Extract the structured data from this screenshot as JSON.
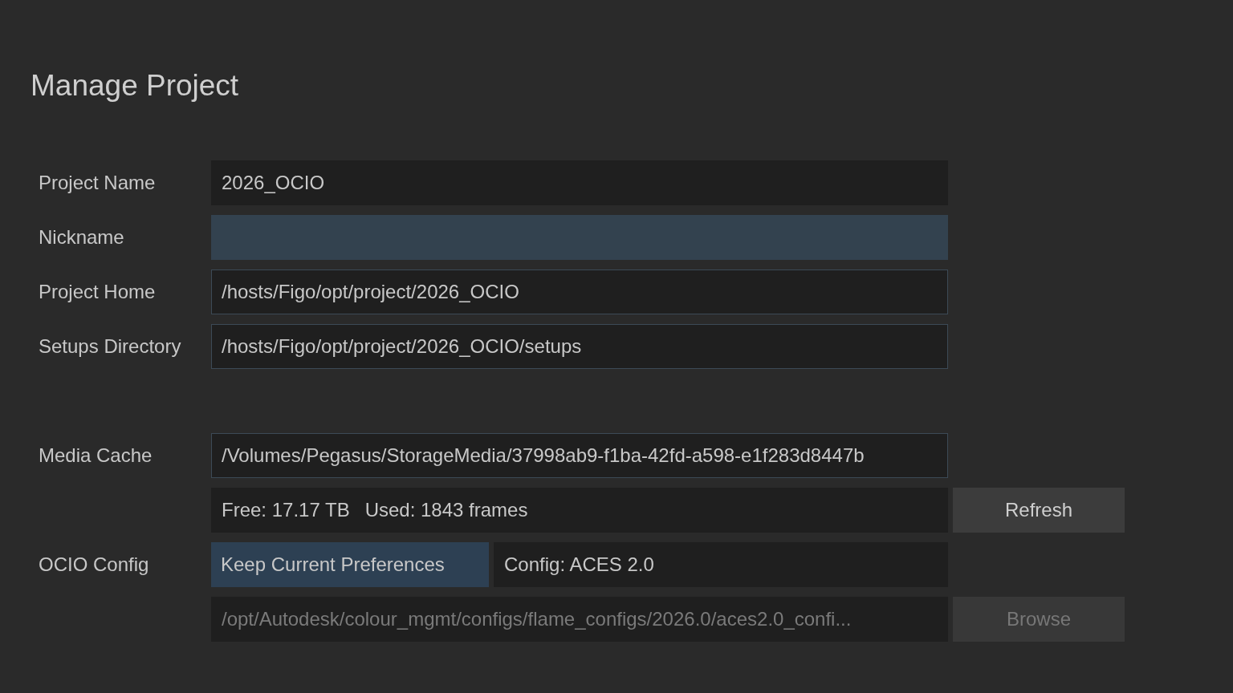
{
  "title": "Manage Project",
  "fields": [
    {
      "label": "Project Name",
      "value": "2026_OCIO",
      "kind": "plain"
    },
    {
      "label": "Nickname",
      "kind": "focused"
    },
    {
      "label": "Project Home",
      "value": "/hosts/Figo/opt/project/2026_OCIO",
      "kind": "outlined"
    },
    {
      "label": "Setups Directory",
      "value": "/hosts/Figo/opt/project/2026_OCIO/setups",
      "kind": "outlined"
    }
  ],
  "media_cache": {
    "label": "Media Cache",
    "value": "/Volumes/Pegasus/StorageMedia/37998ab9-f1ba-42fd-a598-e1f283d8447b",
    "free": "Free: 17.17 TB",
    "used": "Used: 1843 frames",
    "refresh": {
      "label": "Refresh",
      "disabled": false
    }
  },
  "ocio": {
    "label": "OCIO Config",
    "mode": {
      "label": "Keep Current Preferences",
      "selected": true
    },
    "config": "Config: ACES 2.0",
    "path": {
      "value": "/opt/Autodesk/colour_mgmt/configs/flame_configs/2026.0/aces2.0_confi...",
      "disabled": true
    },
    "browse": {
      "label": "Browse",
      "disabled": true
    }
  }
}
